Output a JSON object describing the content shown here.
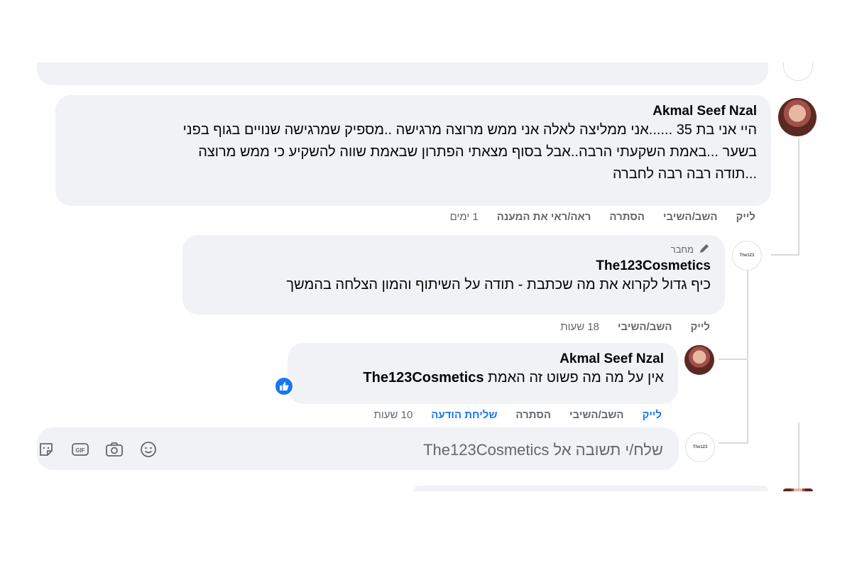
{
  "comment1": {
    "author": "Akmal Seef Nzal",
    "lines": [
      "היי אני בת 35 ......אני ממליצה לאלה אני ממש מרוצה מרגישה ..מספיק שמרגישה שנויים בגוף בפני",
      "בשער ...באמת השקעתי הרבה..אבל בסוף מצאתי הפתרון שבאמת שווה להשקיע כי ממש מרוצה",
      "...תודה רבה רבה לחברה"
    ],
    "actions": {
      "like": "לייק",
      "reply": "השב/השיבי",
      "hide": "הסתרה",
      "see_reply": "ראה/ראי את המענה",
      "time": "1 ימים"
    }
  },
  "reply1": {
    "author_tag": "מחבר",
    "author": "The123Cosmetics",
    "text": "כיף גדול לקרוא את מה שכתבת - תודה על השיתוף והמון הצלחה בהמשך",
    "actions": {
      "like": "לייק",
      "reply": "השב/השיבי",
      "time": "18 שעות"
    }
  },
  "reply2": {
    "author": "Akmal Seef Nzal",
    "mention": "The123Cosmetics",
    "text": "אין על מה מה פשוט זה האמת",
    "actions": {
      "like": "לייק",
      "reply": "השב/השיבי",
      "hide": "הסתרה",
      "send_message": "שליחת הודעה",
      "time": "10 שעות"
    }
  },
  "reply_box": {
    "placeholder": "שלח/י תשובה אל The123Cosmetics",
    "icons": [
      "emoji-icon",
      "camera-icon",
      "gif-icon",
      "sticker-icon"
    ]
  },
  "colors": {
    "bubble": "#f0f2f5",
    "accent": "#1877f2",
    "muted": "#65676b"
  }
}
